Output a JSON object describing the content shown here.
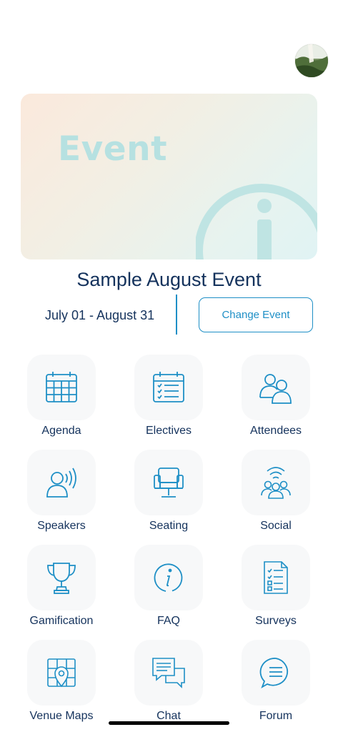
{
  "banner": {
    "text": "Event"
  },
  "event": {
    "title": "Sample August Event",
    "dates": "July 01 - August 31",
    "change_label": "Change Event"
  },
  "colors": {
    "accent": "#1e8fc6",
    "text": "#14325c",
    "tile_bg": "#f7f8f9"
  },
  "menu": [
    {
      "label": "Agenda",
      "icon": "calendar-grid-icon"
    },
    {
      "label": "Electives",
      "icon": "calendar-checklist-icon"
    },
    {
      "label": "Attendees",
      "icon": "people-icon"
    },
    {
      "label": "Speakers",
      "icon": "speaker-icon"
    },
    {
      "label": "Seating",
      "icon": "armchair-icon"
    },
    {
      "label": "Social",
      "icon": "group-broadcast-icon"
    },
    {
      "label": "Gamification",
      "icon": "trophy-icon"
    },
    {
      "label": "FAQ",
      "icon": "info-icon"
    },
    {
      "label": "Surveys",
      "icon": "checklist-document-icon"
    },
    {
      "label": "Venue Maps",
      "icon": "map-pin-icon"
    },
    {
      "label": "Chat",
      "icon": "chat-bubbles-icon"
    },
    {
      "label": "Forum",
      "icon": "chat-bubble-icon"
    }
  ]
}
